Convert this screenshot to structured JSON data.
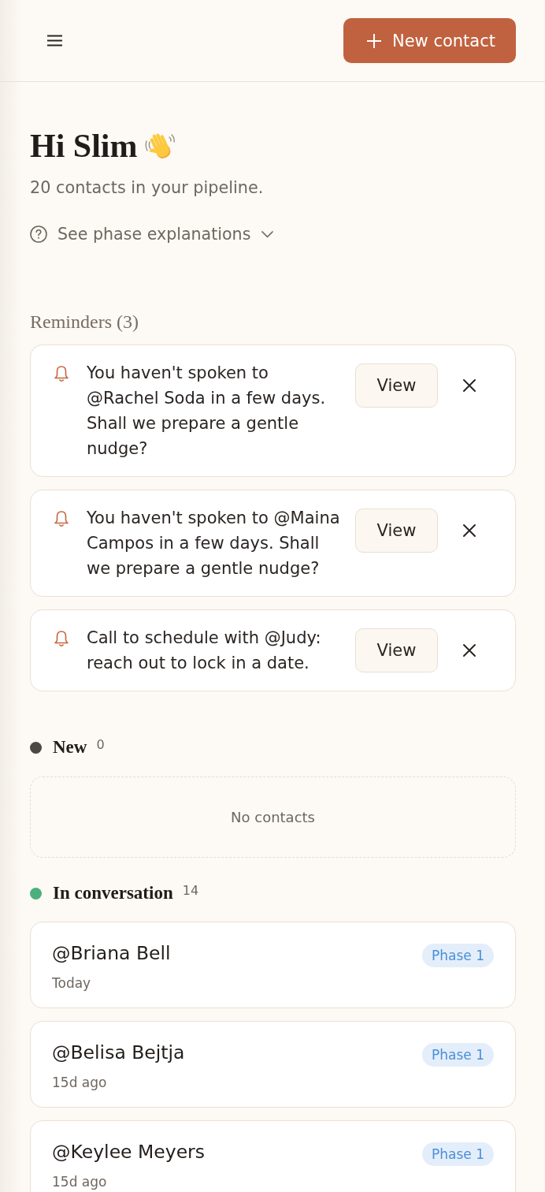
{
  "header": {
    "new_contact_button": "New contact"
  },
  "greeting": {
    "title": "Hi Slim",
    "subtitle": "20 contacts in your pipeline."
  },
  "phase_explanations": {
    "label": "See phase explanations",
    "expanded": false
  },
  "reminders": {
    "title": "Reminders (3)",
    "items": [
      {
        "text": "You haven't spoken to @Rachel Soda in a few days. Shall we prepare a gentle nudge?",
        "action": "View"
      },
      {
        "text": "You haven't spoken to @Maina Campos in a few days. Shall we prepare a gentle nudge?",
        "action": "View"
      },
      {
        "text": "Call to schedule with @Judy: reach out to lock in a date.",
        "action": "View"
      }
    ]
  },
  "phases": [
    {
      "name": "New",
      "count": "0",
      "color": "#4a4744",
      "empty_text": "No contacts"
    },
    {
      "name": "In conversation",
      "count": "14",
      "color": "#4caf7e",
      "contacts": [
        {
          "name": "@Briana Bell",
          "last_contact": "Today",
          "phase": "Phase 1"
        },
        {
          "name": "@Belisa Bejtja",
          "last_contact": "15d ago",
          "phase": "Phase 1"
        },
        {
          "name": "@Keylee Meyers",
          "last_contact": "15d ago",
          "phase": "Phase 1"
        }
      ]
    }
  ]
}
